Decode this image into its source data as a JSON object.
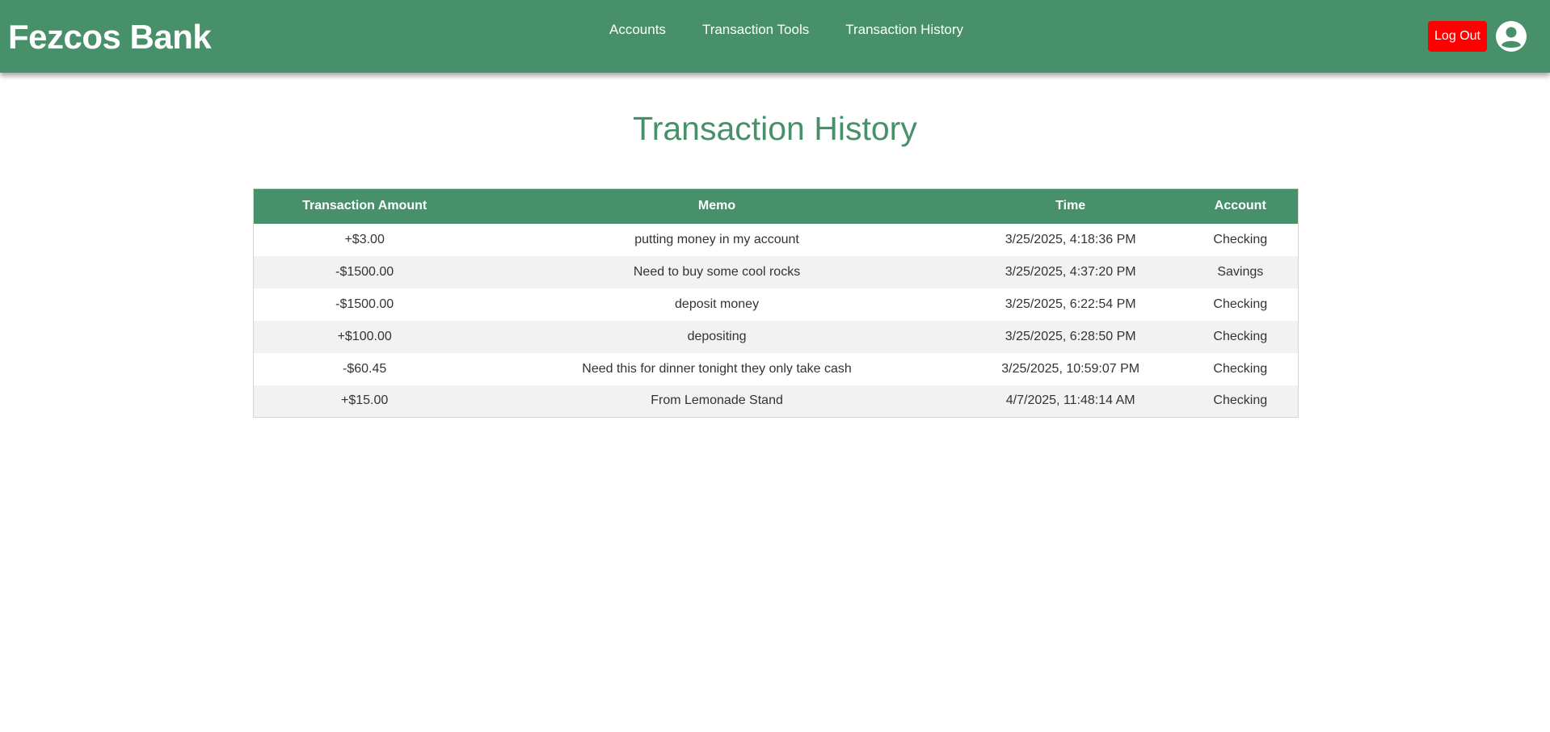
{
  "header": {
    "brand": "Fezcos Bank",
    "nav": [
      "Accounts",
      "Transaction Tools",
      "Transaction History"
    ],
    "logout_label": "Log Out",
    "avatar_icon": "user-circle-icon",
    "accent_color": "#47906a",
    "logout_color": "#ff0000"
  },
  "main": {
    "title": "Transaction History",
    "table": {
      "columns": [
        "Transaction Amount",
        "Memo",
        "Time",
        "Account"
      ],
      "rows": [
        [
          "+$3.00",
          "putting money in my account",
          "3/25/2025, 4:18:36 PM",
          "Checking"
        ],
        [
          "-$1500.00",
          "Need to buy some cool rocks",
          "3/25/2025, 4:37:20 PM",
          "Savings"
        ],
        [
          "-$1500.00",
          "deposit money",
          "3/25/2025, 6:22:54 PM",
          "Checking"
        ],
        [
          "+$100.00",
          "depositing",
          "3/25/2025, 6:28:50 PM",
          "Checking"
        ],
        [
          "-$60.45",
          "Need this for dinner tonight they only take cash",
          "3/25/2025, 10:59:07 PM",
          "Checking"
        ],
        [
          "+$15.00",
          "From Lemonade Stand",
          "4/7/2025, 11:48:14 AM",
          "Checking"
        ]
      ]
    }
  }
}
